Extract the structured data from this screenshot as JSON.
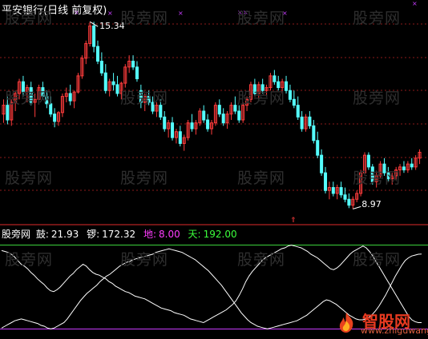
{
  "title": "平安银行(日线 前复权)",
  "colors": {
    "background": "#000000",
    "up": "#ff3c3c",
    "down": "#54ffff",
    "grid": "#8b1a1a",
    "divider": "#b22222",
    "line": "#ffffff",
    "green_level": "#3cd23c",
    "purple_level": "#c83cff"
  },
  "watermark_text": "股旁网",
  "logo": {
    "text": "智股网",
    "url": "www.zhiguwang.cn"
  },
  "indicator": {
    "name": "股旁网",
    "items": [
      {
        "label": "鼓:",
        "value": "21.93",
        "color": "#ffffff"
      },
      {
        "label": "锣:",
        "value": "172.32",
        "color": "#ffffff"
      },
      {
        "label": "地:",
        "value": "8.00",
        "color": "#ff3cff"
      },
      {
        "label": "天:",
        "value": "192.00",
        "color": "#3cff3c"
      }
    ]
  },
  "chart_data": [
    {
      "type": "candlestick",
      "title": "平安银行(日线 前复权)",
      "annotations": [
        {
          "text": "15.34",
          "kind": "high"
        },
        {
          "text": "8.97",
          "kind": "low"
        }
      ],
      "ylim": [
        8.6,
        15.7
      ],
      "grid": true,
      "candles": [
        [
          12.2,
          12.7,
          11.9,
          12.5
        ],
        [
          12.5,
          12.8,
          11.85,
          12.0
        ],
        [
          12.0,
          12.7,
          11.8,
          12.6
        ],
        [
          12.6,
          13.0,
          12.3,
          12.9
        ],
        [
          12.9,
          13.4,
          12.7,
          13.3
        ],
        [
          13.3,
          13.5,
          12.8,
          12.95
        ],
        [
          12.95,
          13.2,
          12.6,
          13.1
        ],
        [
          13.1,
          13.3,
          12.5,
          12.6
        ],
        [
          12.6,
          12.9,
          12.1,
          12.7
        ],
        [
          12.7,
          13.2,
          12.6,
          13.1
        ],
        [
          13.1,
          13.3,
          12.7,
          12.8
        ],
        [
          12.8,
          13.0,
          12.4,
          12.55
        ],
        [
          12.55,
          12.8,
          12.1,
          12.2
        ],
        [
          12.2,
          12.4,
          11.75,
          11.95
        ],
        [
          11.95,
          12.3,
          11.8,
          12.25
        ],
        [
          12.25,
          12.9,
          12.1,
          12.8
        ],
        [
          12.8,
          13.1,
          12.6,
          12.9
        ],
        [
          12.9,
          13.2,
          12.5,
          12.65
        ],
        [
          12.65,
          13.0,
          12.4,
          12.95
        ],
        [
          12.95,
          13.6,
          12.9,
          13.5
        ],
        [
          13.5,
          14.2,
          13.4,
          14.1
        ],
        [
          14.1,
          14.7,
          13.9,
          14.6
        ],
        [
          14.6,
          15.34,
          14.5,
          15.2
        ],
        [
          15.2,
          15.34,
          14.3,
          14.5
        ],
        [
          14.5,
          14.7,
          13.9,
          14.0
        ],
        [
          14.0,
          14.3,
          13.5,
          13.6
        ],
        [
          13.6,
          13.9,
          12.9,
          13.0
        ],
        [
          13.0,
          13.4,
          12.8,
          13.3
        ],
        [
          13.3,
          13.6,
          13.0,
          13.2
        ],
        [
          13.2,
          13.5,
          12.8,
          12.9
        ],
        [
          12.9,
          13.3,
          12.7,
          13.25
        ],
        [
          13.25,
          13.9,
          13.1,
          13.8
        ],
        [
          13.8,
          14.2,
          13.6,
          14.0
        ],
        [
          14.0,
          14.2,
          13.7,
          13.8
        ],
        [
          13.8,
          14.0,
          13.3,
          13.4
        ],
        [
          13.0,
          13.2,
          12.4,
          12.6
        ],
        [
          12.6,
          12.9,
          12.3,
          12.8
        ],
        [
          12.8,
          13.0,
          12.5,
          12.6
        ],
        [
          12.6,
          12.8,
          12.2,
          12.3
        ],
        [
          12.3,
          12.6,
          12.1,
          12.5
        ],
        [
          12.5,
          12.7,
          12.0,
          12.1
        ],
        [
          12.1,
          12.3,
          11.6,
          11.7
        ],
        [
          11.7,
          12.0,
          11.4,
          11.9
        ],
        [
          11.9,
          12.1,
          11.3,
          11.4
        ],
        [
          11.4,
          11.7,
          11.2,
          11.6
        ],
        [
          11.6,
          11.8,
          11.1,
          11.2
        ],
        [
          11.2,
          11.5,
          10.95,
          11.4
        ],
        [
          11.4,
          12.0,
          11.3,
          11.9
        ],
        [
          11.9,
          12.2,
          11.6,
          11.7
        ],
        [
          11.7,
          12.0,
          11.5,
          11.9
        ],
        [
          11.9,
          12.4,
          11.8,
          12.3
        ],
        [
          12.3,
          12.5,
          11.9,
          12.0
        ],
        [
          12.0,
          12.2,
          11.6,
          11.7
        ],
        [
          11.7,
          12.0,
          11.5,
          11.9
        ],
        [
          11.9,
          12.6,
          11.8,
          12.5
        ],
        [
          12.5,
          12.7,
          12.1,
          12.2
        ],
        [
          12.2,
          12.4,
          11.8,
          11.9
        ],
        [
          11.9,
          12.3,
          11.7,
          12.2
        ],
        [
          12.2,
          12.6,
          12.0,
          12.5
        ],
        [
          12.5,
          12.8,
          12.2,
          12.3
        ],
        [
          12.3,
          12.5,
          11.9,
          12.0
        ],
        [
          12.0,
          12.6,
          11.9,
          12.5
        ],
        [
          12.5,
          12.8,
          12.3,
          12.7
        ],
        [
          12.7,
          13.3,
          12.6,
          13.2
        ],
        [
          13.2,
          13.4,
          12.8,
          12.9
        ],
        [
          12.9,
          13.3,
          12.7,
          13.2
        ],
        [
          13.2,
          13.4,
          12.9,
          13.0
        ],
        [
          13.0,
          13.2,
          12.8,
          13.1
        ],
        [
          13.1,
          13.6,
          13.0,
          13.5
        ],
        [
          13.5,
          13.7,
          13.2,
          13.3
        ],
        [
          13.3,
          13.5,
          13.0,
          13.1
        ],
        [
          13.1,
          13.4,
          12.9,
          13.3
        ],
        [
          13.3,
          13.5,
          12.9,
          13.0
        ],
        [
          13.0,
          13.2,
          12.6,
          12.7
        ],
        [
          12.7,
          13.0,
          12.4,
          12.5
        ],
        [
          12.5,
          12.8,
          12.0,
          12.1
        ],
        [
          12.1,
          12.3,
          11.6,
          11.7
        ],
        [
          11.7,
          12.2,
          11.6,
          12.1
        ],
        [
          12.1,
          12.3,
          11.7,
          11.8
        ],
        [
          11.8,
          12.0,
          11.2,
          11.3
        ],
        [
          11.3,
          11.6,
          10.7,
          10.8
        ],
        [
          10.8,
          11.0,
          10.1,
          10.2
        ],
        [
          10.2,
          10.4,
          9.5,
          9.6
        ],
        [
          9.6,
          9.9,
          9.3,
          9.7
        ],
        [
          9.7,
          9.9,
          9.4,
          9.5
        ],
        [
          9.5,
          9.8,
          9.3,
          9.7
        ],
        [
          9.7,
          9.9,
          9.35,
          9.45
        ],
        [
          9.45,
          9.7,
          9.2,
          9.3
        ],
        [
          9.3,
          9.5,
          9.0,
          9.1
        ],
        [
          9.1,
          9.4,
          8.97,
          9.3
        ],
        [
          9.3,
          9.6,
          9.2,
          9.5
        ],
        [
          9.5,
          10.3,
          9.4,
          10.2
        ],
        [
          10.2,
          10.9,
          10.1,
          10.8
        ],
        [
          10.8,
          10.9,
          10.3,
          10.4
        ],
        [
          10.4,
          10.5,
          9.8,
          9.9
        ],
        [
          9.9,
          10.2,
          9.7,
          10.1
        ],
        [
          10.1,
          10.6,
          10.0,
          10.5
        ],
        [
          10.5,
          10.7,
          10.1,
          10.2
        ],
        [
          10.2,
          10.4,
          9.9,
          10.0
        ],
        [
          10.0,
          10.2,
          9.8,
          10.1
        ],
        [
          10.1,
          10.4,
          9.95,
          10.3
        ],
        [
          10.3,
          10.5,
          10.1,
          10.4
        ],
        [
          10.4,
          10.6,
          10.2,
          10.3
        ],
        [
          10.3,
          10.6,
          10.2,
          10.5
        ],
        [
          10.5,
          10.7,
          10.3,
          10.4
        ],
        [
          10.4,
          10.8,
          10.3,
          10.7
        ],
        [
          10.7,
          11.0,
          10.5,
          10.9
        ]
      ]
    },
    {
      "type": "line",
      "series": [
        {
          "name": "鼓",
          "values": [
            180,
            178,
            176,
            172,
            166,
            158,
            150,
            146,
            140,
            132,
            126,
            118,
            112,
            106,
            98,
            92,
            90,
            94,
            100,
            108,
            116,
            124,
            130,
            138,
            144,
            150,
            146,
            138,
            132,
            128,
            126,
            122,
            118,
            112,
            108,
            102,
            98,
            94,
            90,
            88,
            84,
            80,
            78,
            76,
            74,
            70,
            66,
            62,
            58,
            54,
            52,
            50,
            48,
            44,
            42,
            40,
            38,
            34,
            30,
            28,
            26,
            24,
            22,
            26,
            30,
            34,
            38,
            42,
            46,
            50,
            56,
            62,
            70,
            82,
            96,
            112,
            124,
            134,
            142,
            150,
            158,
            164,
            168,
            172,
            176,
            180,
            184,
            186,
            190,
            192,
            190,
            188,
            186,
            182,
            178,
            172,
            168,
            164,
            158,
            152,
            146,
            140,
            138,
            142,
            148,
            156,
            164,
            172,
            178,
            182,
            186,
            190,
            186,
            178,
            168,
            156,
            144,
            132,
            120,
            108,
            96,
            84,
            72,
            60,
            48,
            36,
            28,
            24,
            22,
            21.93
          ]
        },
        {
          "name": "锣",
          "values": [
            10,
            14,
            18,
            22,
            26,
            28,
            30,
            28,
            26,
            24,
            22,
            20,
            16,
            14,
            10,
            8,
            10,
            14,
            18,
            22,
            30,
            40,
            50,
            60,
            70,
            78,
            86,
            92,
            98,
            104,
            112,
            118,
            124,
            128,
            134,
            140,
            146,
            150,
            154,
            156,
            160,
            162,
            164,
            166,
            168,
            170,
            172,
            176,
            178,
            180,
            182,
            184,
            182,
            180,
            178,
            176,
            172,
            168,
            164,
            160,
            154,
            148,
            142,
            136,
            128,
            120,
            112,
            104,
            94,
            84,
            74,
            64,
            54,
            44,
            36,
            28,
            22,
            18,
            14,
            12,
            10,
            8,
            10,
            12,
            14,
            16,
            18,
            20,
            22,
            24,
            26,
            30,
            34,
            38,
            44,
            50,
            56,
            62,
            68,
            72,
            70,
            66,
            62,
            56,
            50,
            44,
            38,
            34,
            30,
            28,
            28,
            30,
            34,
            40,
            48,
            58,
            70,
            82,
            96,
            110,
            124,
            136,
            148,
            158,
            164,
            168,
            170,
            172,
            172.32
          ]
        }
      ],
      "levels": [
        {
          "name": "地",
          "value": 8.0
        },
        {
          "name": "天",
          "value": 192.0
        }
      ],
      "ylim": [
        0,
        200
      ]
    }
  ]
}
